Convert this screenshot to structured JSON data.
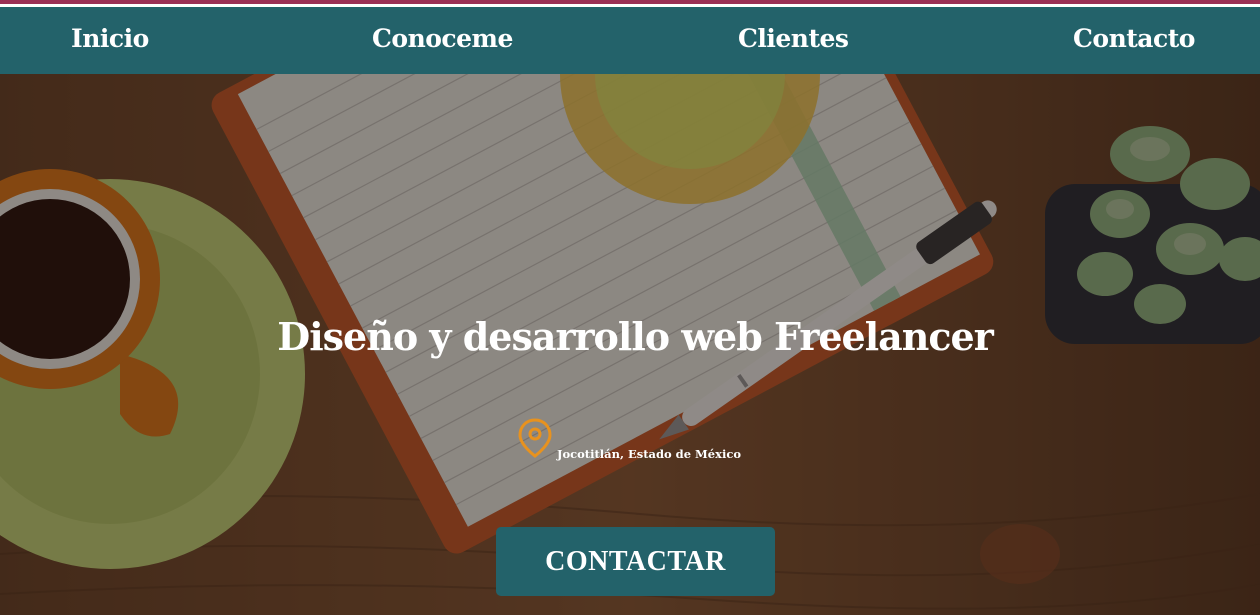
{
  "nav": {
    "items": [
      {
        "label": "Inicio"
      },
      {
        "label": "Conoceme"
      },
      {
        "label": "Clientes"
      },
      {
        "label": "Contacto"
      }
    ]
  },
  "hero": {
    "title": "Diseño y desarrollo web Freelancer",
    "location": "Jocotitlán, Estado de México",
    "location_icon": "map-pin-icon",
    "cta_label": "CONTACTAR"
  },
  "colors": {
    "accent": "#23626a",
    "stripe": "#9c2f55",
    "pin": "#e8921e"
  }
}
